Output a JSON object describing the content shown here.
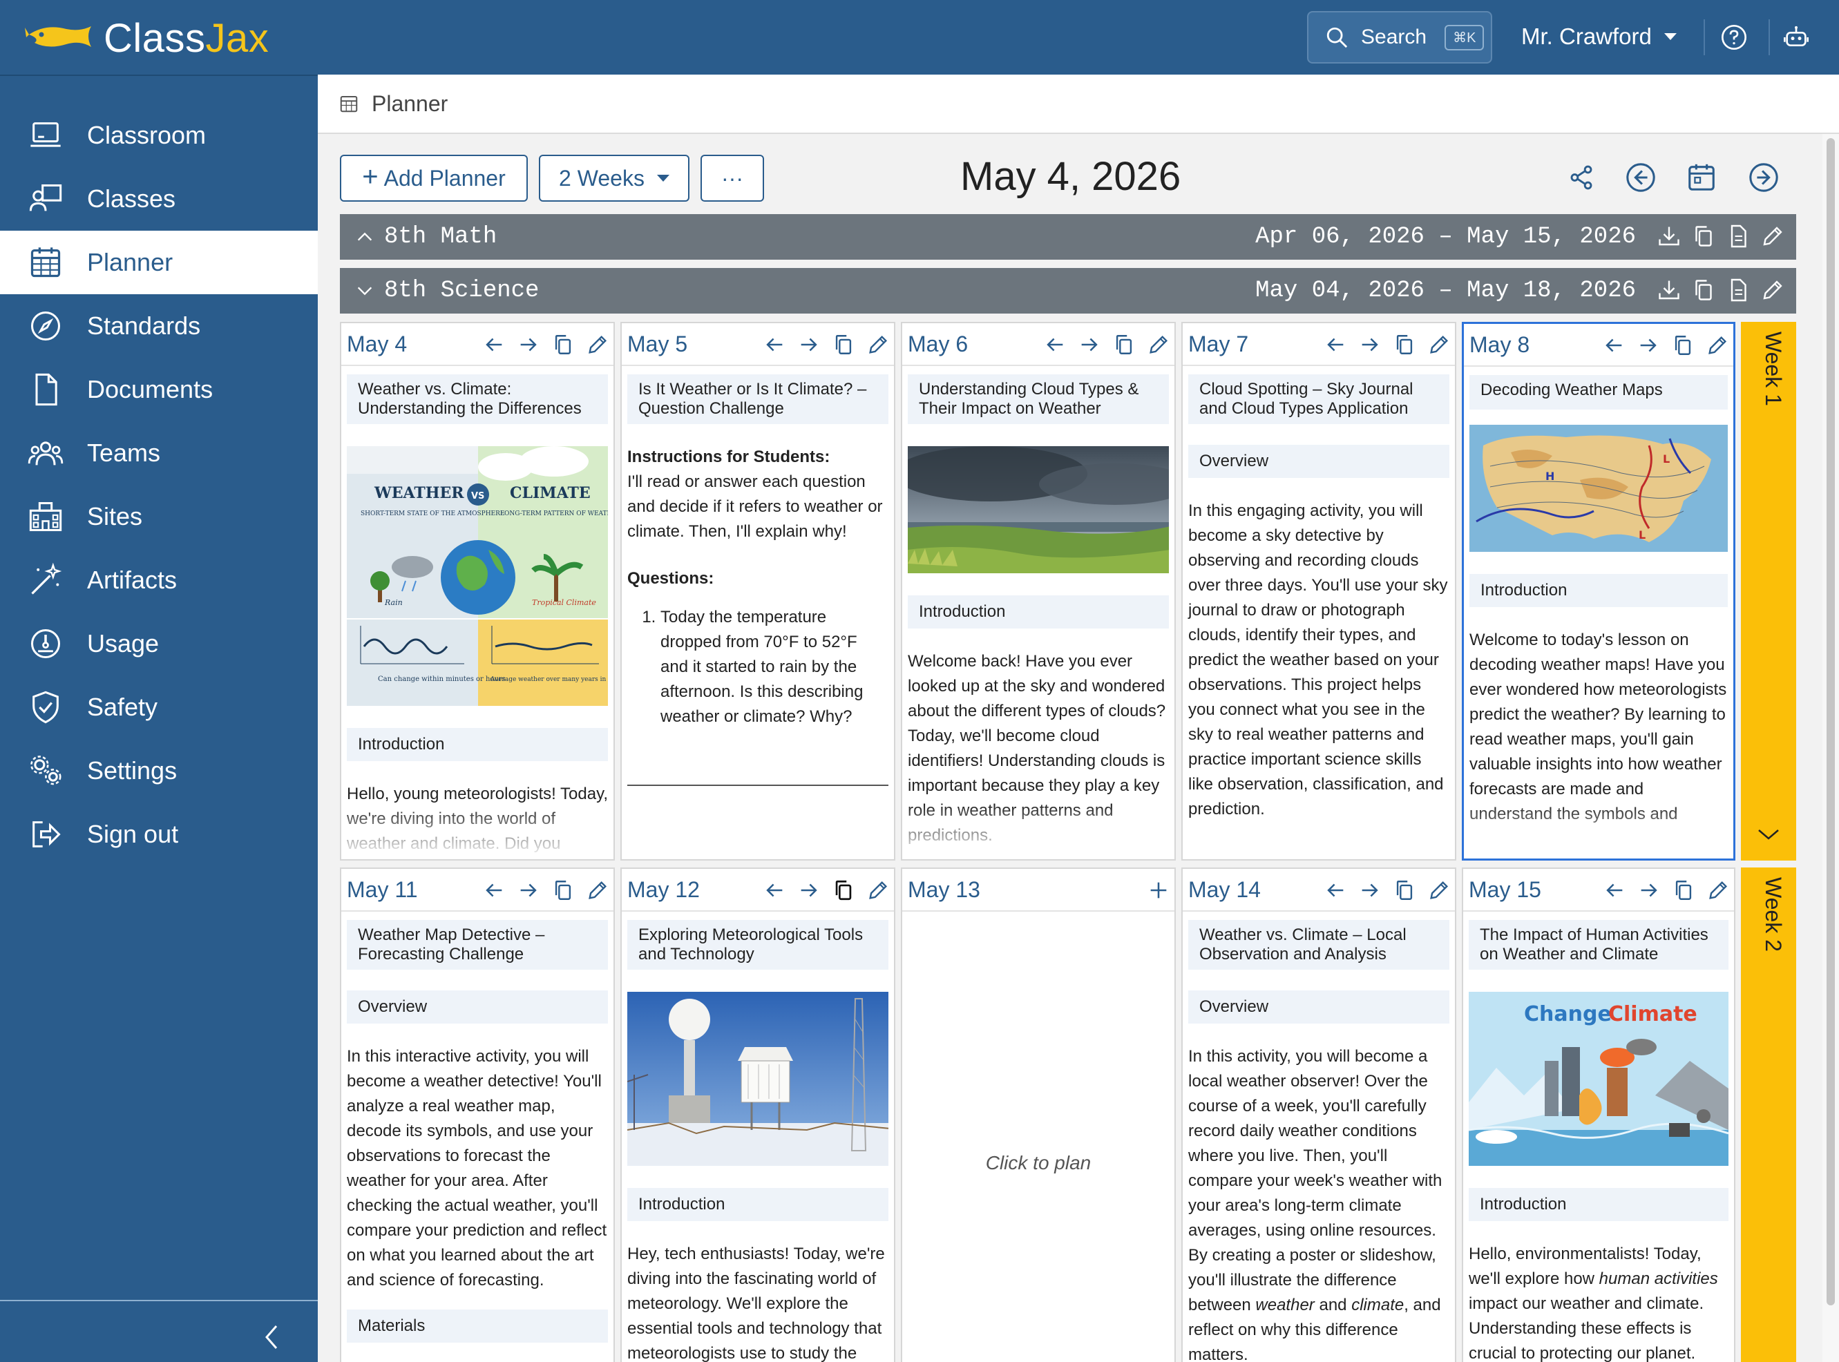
{
  "app": {
    "name_prefix": "Class",
    "name_suffix": "Jax"
  },
  "header": {
    "search_label": "Search",
    "search_shortcut": "⌘K",
    "user_name": "Mr. Crawford"
  },
  "sidebar": {
    "items": [
      {
        "label": "Classroom",
        "icon": "classroom-icon"
      },
      {
        "label": "Classes",
        "icon": "classes-icon"
      },
      {
        "label": "Planner",
        "icon": "calendar-icon",
        "active": true
      },
      {
        "label": "Standards",
        "icon": "compass-icon"
      },
      {
        "label": "Documents",
        "icon": "document-icon"
      },
      {
        "label": "Teams",
        "icon": "teams-icon"
      },
      {
        "label": "Sites",
        "icon": "building-icon"
      },
      {
        "label": "Artifacts",
        "icon": "magic-wand-icon"
      },
      {
        "label": "Usage",
        "icon": "gauge-icon"
      },
      {
        "label": "Safety",
        "icon": "shield-icon"
      },
      {
        "label": "Settings",
        "icon": "gears-icon"
      },
      {
        "label": "Sign out",
        "icon": "sign-out-icon"
      }
    ]
  },
  "breadcrumb": {
    "label": "Planner"
  },
  "toolbar": {
    "add_planner": "Add Planner",
    "range_select": "2 Weeks",
    "more": "···",
    "current_date": "May 4, 2026"
  },
  "subjects": [
    {
      "name": "8th Math",
      "range": "Apr 06, 2026 – May 15, 2026",
      "expanded": false
    },
    {
      "name": "8th Science",
      "range": "May 04, 2026 – May 18, 2026",
      "expanded": true
    }
  ],
  "weeks": [
    {
      "label": "Week 1"
    },
    {
      "label": "Week 2"
    }
  ],
  "days": {
    "may4": {
      "date": "May 4",
      "title": "Weather vs. Climate: Understanding the Differences",
      "image": {
        "weather": "WEATHER",
        "climate": "CLIMATE",
        "vs": "VS",
        "weather_sub": "SHORT-TERM STATE OF THE ATMOSPHERE",
        "climate_sub": "LONG-TERM PATTERN OF WEATHER",
        "rain": "Rain",
        "tropical": "Tropical Climate",
        "left_caption": "Can change within minutes or hours",
        "right_caption": "Average weather over many years in one specific place"
      },
      "section": "Introduction",
      "text": "Hello, young meteorologists! Today, we're diving into the world of weather and climate. Did you"
    },
    "may5": {
      "date": "May 5",
      "title": "Is It Weather or Is It Climate? – Question Challenge",
      "instructions_heading": "Instructions for Students:",
      "instructions": "I'll read or answer each question and decide if it refers to weather or climate. Then, I'll explain why!",
      "questions_heading": "Questions:",
      "question_1": "Today the temperature dropped from 70°F to 52°F and it started to rain by the afternoon. Is this describing weather or climate? Why?"
    },
    "may6": {
      "date": "May 6",
      "title": "Understanding Cloud Types & Their Impact on Weather",
      "section": "Introduction",
      "text": "Welcome back! Have you ever looked up at the sky and wondered about the different types of clouds? Today, we'll become cloud identifiers! Understanding clouds is important because they play a key role in weather patterns and predictions."
    },
    "may7": {
      "date": "May 7",
      "title": "Cloud Spotting – Sky Journal and Cloud Types Application",
      "section": "Overview",
      "text": "In this engaging activity, you will become a sky detective by observing and recording clouds over three days. You'll use your sky journal to draw or photograph clouds, identify their types, and predict the weather based on your observations. This project helps you connect what you see in the sky to real weather patterns and practice important science skills like observation, classification, and prediction."
    },
    "may8": {
      "date": "May 8",
      "title": "Decoding Weather Maps",
      "map_high": "H",
      "map_low": "L",
      "section": "Introduction",
      "text": "Welcome to today's lesson on decoding weather maps! Have you ever wondered how meteorologists predict the weather? By learning to read weather maps, you'll gain valuable insights into how weather forecasts are made and understand the symbols and"
    },
    "may11": {
      "date": "May 11",
      "title": "Weather Map Detective – Forecasting Challenge",
      "section": "Overview",
      "text": "In this interactive activity, you will become a weather detective! You'll analyze a real weather map, decode its symbols, and use your observations to forecast the weather for your area. After checking the actual weather, you'll compare your prediction and reflect on what you learned about the art and science of forecasting.",
      "section2": "Materials"
    },
    "may12": {
      "date": "May 12",
      "title": "Exploring Meteorological Tools and Technology",
      "section": "Introduction",
      "text": "Hey, tech enthusiasts! Today, we're diving into the fascinating world of meteorology. We'll explore the essential tools and technology that meteorologists use to study the"
    },
    "may13": {
      "date": "May 13",
      "placeholder": "Click to plan"
    },
    "may14": {
      "date": "May 14",
      "title": "Weather vs. Climate – Local Observation and Analysis",
      "section": "Overview",
      "text_before_weather": "In this activity, you will become a local weather observer! Over the course of a week, you'll carefully record daily weather conditions where you live. Then, you'll compare your week's weather with your area's long-term climate averages, using online resources. By creating a poster or slideshow, you'll illustrate the difference between ",
      "em_weather": "weather",
      "text_and": " and ",
      "em_climate": "climate",
      "text_after": ", and reflect on why this difference matters."
    },
    "may15": {
      "date": "May 15",
      "title": "The Impact of Human Activities on Weather and Climate",
      "image_word_1": "Change",
      "image_word_2": "Climate",
      "section": "Introduction",
      "text_before": "Hello, environmentalists! Today, we'll explore how ",
      "em_human": "human activities",
      "text_after": " impact our weather and climate. Understanding these effects is crucial to protecting our planet."
    }
  },
  "colors": {
    "brand_blue": "#2a5c8c",
    "brand_yellow": "#f5c51b",
    "week_bar": "#fbbf08",
    "subject_bar": "#6c757d",
    "selected_border": "#2d72d9"
  }
}
